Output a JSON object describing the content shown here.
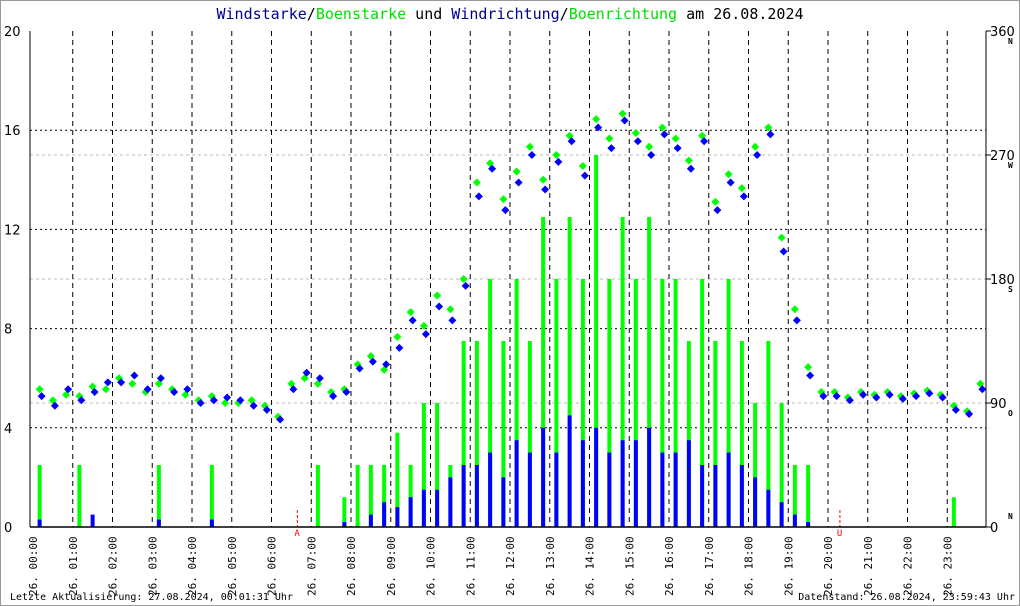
{
  "title": {
    "part1": "Windstarke",
    "sep1": "/",
    "part2": "Boenstarke",
    "mid": " und ",
    "part3": "Windrichtung",
    "sep2": "/",
    "part4": "Boenrichtung",
    "end": " am 26.08.2024"
  },
  "footer": {
    "left": "Letzte Aktualisierung: 27.08.2024, 00:01:31 Uhr",
    "right": "Datenstand: 26.08.2024, 23:59:43 Uhr"
  },
  "colors": {
    "speed": "#0000ff",
    "gust": "#00ff00",
    "title_blue": "#00008b",
    "marker": "#ff0000"
  },
  "chart_data": {
    "type": "scatter",
    "title": "Windstarke/Boenstarke und Windrichtung/Boenrichtung am 26.08.2024",
    "xlabel": "",
    "ylabel": "",
    "y_left": {
      "range": [
        0,
        20
      ],
      "ticks": [
        "0",
        "4",
        "8",
        "12",
        "16",
        "20"
      ]
    },
    "y_right": {
      "range": [
        0,
        360
      ],
      "ticks": [
        "0",
        "90",
        "180",
        "270",
        "360"
      ],
      "compass": [
        "N",
        "O",
        "S",
        "W",
        "N"
      ]
    },
    "x_range_hours": [
      0,
      24
    ],
    "x_ticks": [
      "26. 00:00",
      "26. 01:00",
      "26. 02:00",
      "26. 03:00",
      "26. 04:00",
      "26. 05:00",
      "26. 06:00",
      "26. 07:00",
      "26. 08:00",
      "26. 09:00",
      "26. 10:00",
      "26. 11:00",
      "26. 12:00",
      "26. 13:00",
      "26. 14:00",
      "26. 15:00",
      "26. 16:00",
      "26. 17:00",
      "26. 18:00",
      "26. 19:00",
      "26. 20:00",
      "26. 21:00",
      "26. 22:00",
      "26. 23:00"
    ],
    "markers": [
      {
        "label": "A",
        "hour": 6.65
      },
      {
        "label": "U",
        "hour": 20.3
      }
    ],
    "sample_interval_minutes": 20,
    "series": [
      {
        "name": "Windstarke",
        "kind": "bar",
        "axis": "left",
        "values": [
          0.3,
          0,
          0,
          0,
          0.5,
          0,
          0,
          0,
          0,
          0.3,
          0,
          0,
          0,
          0.3,
          0,
          0,
          0,
          0,
          0,
          0,
          0,
          0,
          0,
          0.2,
          0,
          0.5,
          1.0,
          0.8,
          1.2,
          1.5,
          1.5,
          2.0,
          2.5,
          2.5,
          3.0,
          2.0,
          3.5,
          3.0,
          4.0,
          3.0,
          4.5,
          3.5,
          4.0,
          3.0,
          3.5,
          3.5,
          4.0,
          3.0,
          3.0,
          3.5,
          2.5,
          2.5,
          3.0,
          2.5,
          2.0,
          1.5,
          1.0,
          0.5,
          0.2,
          0,
          0,
          0,
          0,
          0,
          0,
          0,
          0,
          0,
          0,
          0,
          0,
          0
        ]
      },
      {
        "name": "Boenstarke",
        "kind": "bar",
        "axis": "left",
        "values": [
          2.5,
          0,
          0,
          2.5,
          0,
          0,
          0,
          0,
          0,
          2.5,
          0,
          0,
          0,
          2.5,
          0,
          0,
          0,
          0,
          0,
          0,
          0,
          2.5,
          0,
          1.2,
          2.5,
          2.5,
          2.5,
          3.8,
          2.5,
          5,
          5,
          2.5,
          7.5,
          7.5,
          10,
          7.5,
          10,
          7.5,
          12.5,
          10,
          12.5,
          10,
          15,
          10,
          12.5,
          10,
          12.5,
          10,
          10,
          7.5,
          10,
          7.5,
          10,
          7.5,
          5,
          7.5,
          5,
          2.5,
          2.5,
          0,
          0,
          0,
          0,
          0,
          0,
          0,
          0,
          0,
          0,
          1.2,
          0,
          0
        ]
      },
      {
        "name": "Windrichtung",
        "kind": "scatter",
        "axis": "right",
        "values": [
          95,
          88,
          100,
          92,
          98,
          105,
          105,
          110,
          100,
          108,
          98,
          100,
          90,
          92,
          94,
          92,
          88,
          85,
          78,
          100,
          112,
          108,
          95,
          98,
          115,
          120,
          118,
          130,
          150,
          140,
          160,
          150,
          175,
          240,
          260,
          230,
          250,
          270,
          245,
          265,
          280,
          255,
          290,
          275,
          295,
          280,
          270,
          285,
          275,
          260,
          280,
          230,
          250,
          240,
          270,
          285,
          200,
          150,
          110,
          95,
          95,
          92,
          96,
          94,
          96,
          93,
          95,
          97,
          94,
          85,
          82,
          100
        ]
      },
      {
        "name": "Boenrichtung",
        "kind": "scatter",
        "axis": "right",
        "values": [
          100,
          92,
          96,
          95,
          102,
          100,
          108,
          104,
          98,
          104,
          100,
          96,
          92,
          95,
          90,
          90,
          92,
          88,
          80,
          104,
          108,
          104,
          98,
          100,
          118,
          124,
          114,
          138,
          156,
          146,
          168,
          158,
          180,
          250,
          264,
          238,
          258,
          276,
          252,
          270,
          284,
          262,
          296,
          282,
          300,
          286,
          276,
          290,
          282,
          266,
          284,
          236,
          256,
          246,
          276,
          290,
          210,
          158,
          116,
          98,
          98,
          94,
          98,
          96,
          98,
          95,
          97,
          99,
          96,
          88,
          84,
          104
        ]
      }
    ]
  }
}
